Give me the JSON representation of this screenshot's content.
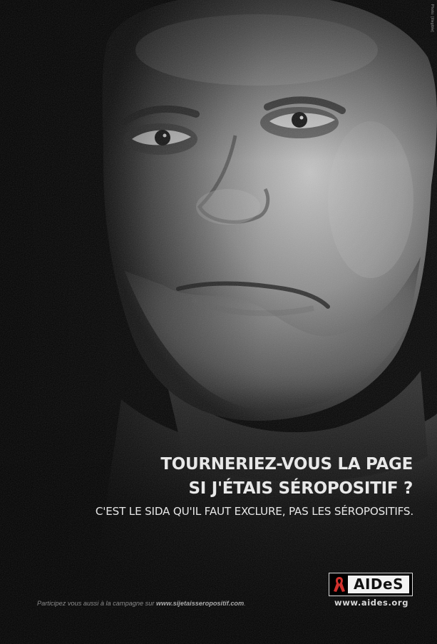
{
  "poster": {
    "credit": "Photo: [illegible]",
    "headline": {
      "line1": "TOURNERIEZ-VOUS LA PAGE",
      "line2": "SI J'ÉTAIS SÉROPOSITIF ?"
    },
    "subline": "C'EST LE SIDA QU'IL FAUT EXCLURE, PAS LES SÉROPOSITIFS.",
    "campaign": {
      "text": "Participez vous aussi à la campagne sur ",
      "url": "www.sijetaisseropositif.com",
      "suffix": "."
    },
    "logo": {
      "wordmark": "AIDeS",
      "url": "www.aides.org",
      "ribbon_icon": "red-ribbon-icon",
      "ribbon_color": "#d0312d"
    }
  }
}
